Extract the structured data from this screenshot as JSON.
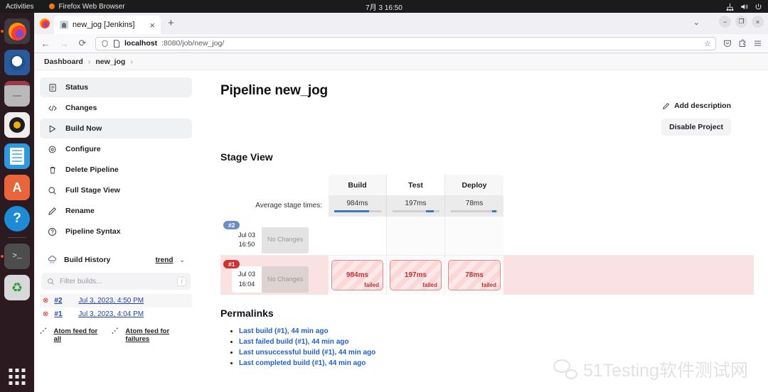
{
  "desktop": {
    "activities": "Activities",
    "app_name": "Firefox Web Browser",
    "clock": "7月 3  16:50",
    "tray_icons": [
      "network-icon",
      "volume-icon",
      "power-icon"
    ],
    "dock": [
      {
        "name": "firefox",
        "running": true
      },
      {
        "name": "thunderbird",
        "running": false
      },
      {
        "name": "files",
        "running": false
      },
      {
        "name": "rhythmbox",
        "running": false
      },
      {
        "name": "libreoffice-writer",
        "running": false
      },
      {
        "name": "ubuntu-software",
        "label": "A",
        "running": false
      },
      {
        "name": "help",
        "label": "?",
        "running": false
      },
      {
        "name": "terminal",
        "label": ">_",
        "running": true
      },
      {
        "name": "trash",
        "label": "♻",
        "running": false
      }
    ]
  },
  "browser": {
    "tab_title": "new_jog [Jenkins]",
    "tab_close": "×",
    "new_tab": "+",
    "url_host": "localhost",
    "url_path": ":8080/job/new_jog/",
    "window_controls": [
      "−",
      "❐",
      "×"
    ]
  },
  "breadcrumb": {
    "items": [
      "Dashboard",
      "new_jog"
    ],
    "separator": "›"
  },
  "sidebar": {
    "items": [
      {
        "label": "Status",
        "icon": "document-icon",
        "active": true
      },
      {
        "label": "Changes",
        "icon": "code-icon",
        "active": false
      },
      {
        "label": "Build Now",
        "icon": "play-icon",
        "active": true
      },
      {
        "label": "Configure",
        "icon": "gear-icon",
        "active": false
      },
      {
        "label": "Delete Pipeline",
        "icon": "trash-icon",
        "active": false
      },
      {
        "label": "Full Stage View",
        "icon": "search-icon",
        "active": false
      },
      {
        "label": "Rename",
        "icon": "pencil-icon",
        "active": false
      },
      {
        "label": "Pipeline Syntax",
        "icon": "question-icon",
        "active": false
      }
    ],
    "build_history": {
      "title": "Build History",
      "icon": "weather-icon",
      "trend_label": "trend",
      "caret": "⌄",
      "filter_placeholder": "Filter builds...",
      "filter_shortcut": "/",
      "search_icon": "search-icon",
      "rows": [
        {
          "status_icon": "failed-icon",
          "number": "#2",
          "date": "Jul 3, 2023, 4:50 PM"
        },
        {
          "status_icon": "failed-icon",
          "number": "#1",
          "date": "Jul 3, 2023, 4:04 PM"
        }
      ],
      "atom_all": "Atom feed for all",
      "atom_failures": "Atom feed for failures"
    }
  },
  "main": {
    "page_title": "Pipeline new_jog",
    "add_description": "Add description",
    "disable_project": "Disable Project",
    "stage_view_heading": "Stage View",
    "average_label": "Average stage times:",
    "permalinks_heading": "Permalinks",
    "permalinks": [
      "Last build (#1), 44 min ago",
      "Last failed build (#1), 44 min ago",
      "Last unsuccessful build (#1), 44 min ago",
      "Last completed build (#1), 44 min ago"
    ]
  },
  "stage_view": {
    "columns": [
      {
        "name": "Build",
        "average": "984ms",
        "bar_start_pct": 0,
        "bar_width_pct": 75
      },
      {
        "name": "Test",
        "average": "197ms",
        "bar_start_pct": 72,
        "bar_width_pct": 17
      },
      {
        "name": "Deploy",
        "average": "78ms",
        "bar_start_pct": 88,
        "bar_width_pct": 9
      }
    ],
    "runs": [
      {
        "badge": "#2",
        "badge_color": "#6b8fc4",
        "date": "Jul 03",
        "time": "16:50",
        "changes": "No\nChanges",
        "failed": false,
        "cells": [
          {
            "duration": ""
          },
          {
            "duration": ""
          },
          {
            "duration": ""
          }
        ]
      },
      {
        "badge": "#1",
        "badge_color": "#d03232",
        "date": "Jul 03",
        "time": "16:04",
        "changes": "No\nChanges",
        "failed": true,
        "cells": [
          {
            "duration": "984ms",
            "state": "failed"
          },
          {
            "duration": "197ms",
            "state": "failed"
          },
          {
            "duration": "78ms",
            "state": "failed"
          }
        ]
      }
    ]
  },
  "watermark": {
    "text": "51Testing软件测试网"
  }
}
